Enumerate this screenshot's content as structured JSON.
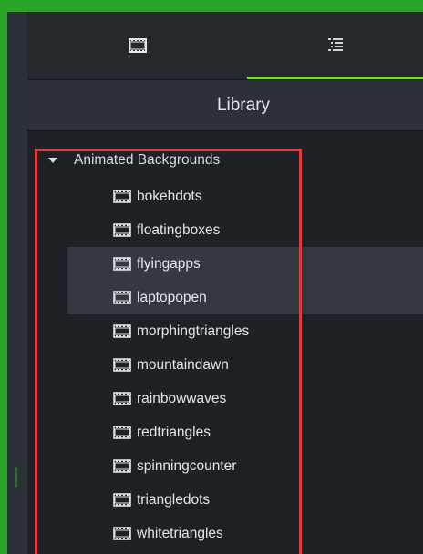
{
  "tabs": [
    {
      "icon": "film-strip-icon"
    },
    {
      "icon": "list-icon",
      "active": true
    }
  ],
  "colors": {
    "accent": "#87d23a",
    "highlight_border": "#e0393e"
  },
  "library": {
    "title": "Library",
    "folder": {
      "label": "Animated Backgrounds",
      "expanded": true,
      "items": [
        {
          "label": "bokehdots"
        },
        {
          "label": "floatingboxes"
        },
        {
          "label": "flyingapps"
        },
        {
          "label": "laptopopen"
        },
        {
          "label": "morphingtriangles"
        },
        {
          "label": "mountaindawn"
        },
        {
          "label": "rainbowwaves"
        },
        {
          "label": "redtriangles"
        },
        {
          "label": "spinningcounter"
        },
        {
          "label": "triangledots"
        },
        {
          "label": "whitetriangles"
        }
      ]
    }
  }
}
